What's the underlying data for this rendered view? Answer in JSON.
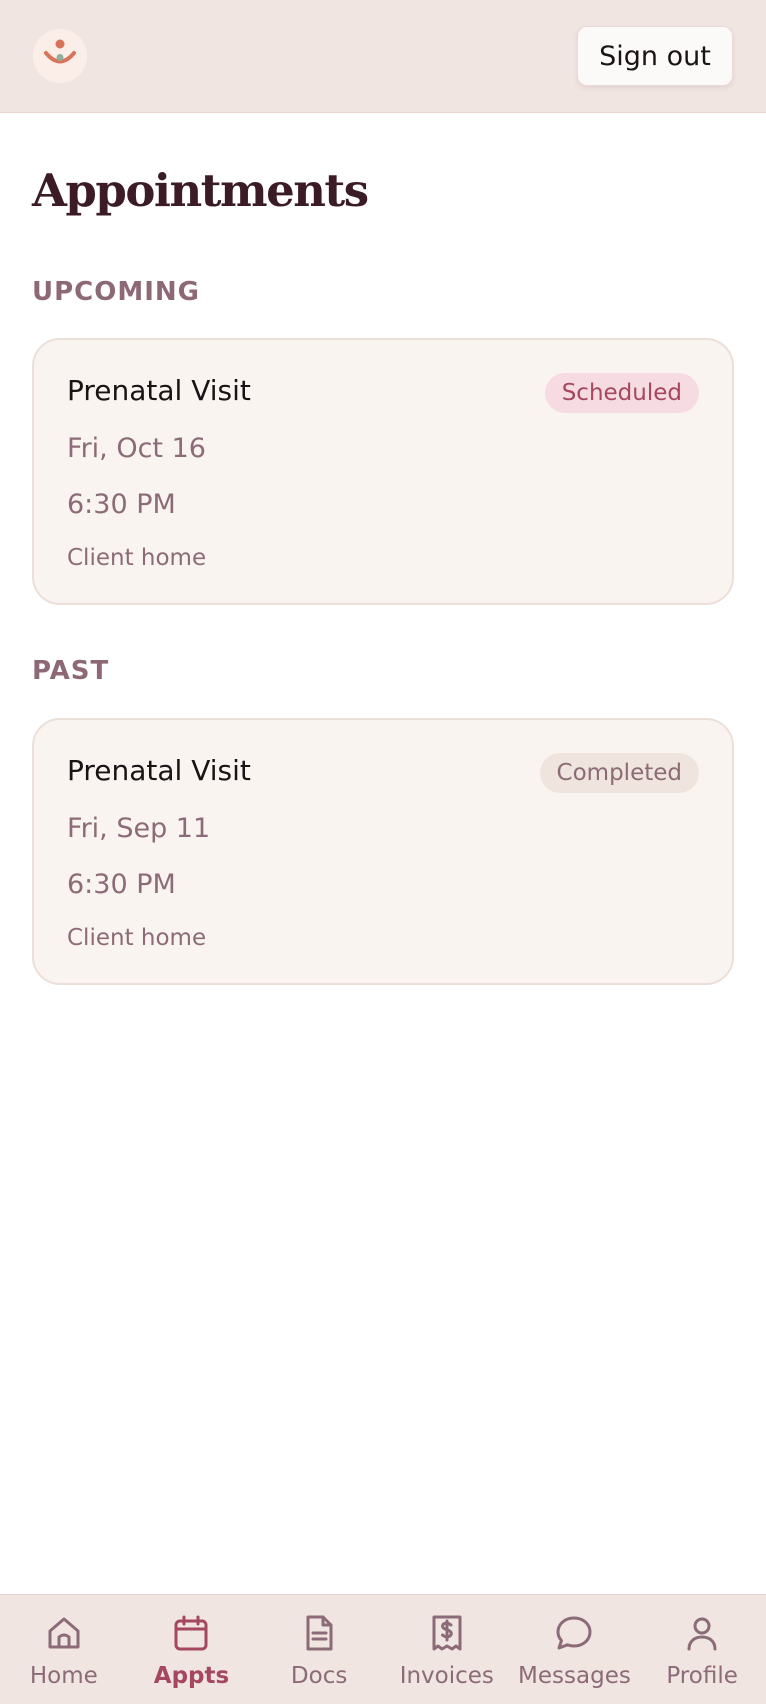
{
  "header": {
    "sign_out_label": "Sign out"
  },
  "page": {
    "title": "Appointments"
  },
  "sections": {
    "upcoming": {
      "label": "UPCOMING",
      "appointments": [
        {
          "title": "Prenatal Visit",
          "status": "Scheduled",
          "date": "Fri, Oct 16",
          "time": "6:30 PM",
          "location": "Client home"
        }
      ]
    },
    "past": {
      "label": "PAST",
      "appointments": [
        {
          "title": "Prenatal Visit",
          "status": "Completed",
          "date": "Fri, Sep 11",
          "time": "6:30 PM",
          "location": "Client home"
        }
      ]
    }
  },
  "nav": {
    "items": [
      {
        "label": "Home",
        "icon": "home-icon",
        "active": false
      },
      {
        "label": "Appts",
        "icon": "calendar-icon",
        "active": true
      },
      {
        "label": "Docs",
        "icon": "document-icon",
        "active": false
      },
      {
        "label": "Invoices",
        "icon": "receipt-icon",
        "active": false
      },
      {
        "label": "Messages",
        "icon": "chat-bubble-icon",
        "active": false
      },
      {
        "label": "Profile",
        "icon": "person-icon",
        "active": false
      }
    ]
  },
  "colors": {
    "accent": "#a5485f",
    "header_bg": "#f1e5e1",
    "title": "#3b1c26",
    "muted": "#8c6b78",
    "scheduled_badge_bg": "#f6dbe2",
    "completed_badge_bg": "#efe4de"
  }
}
